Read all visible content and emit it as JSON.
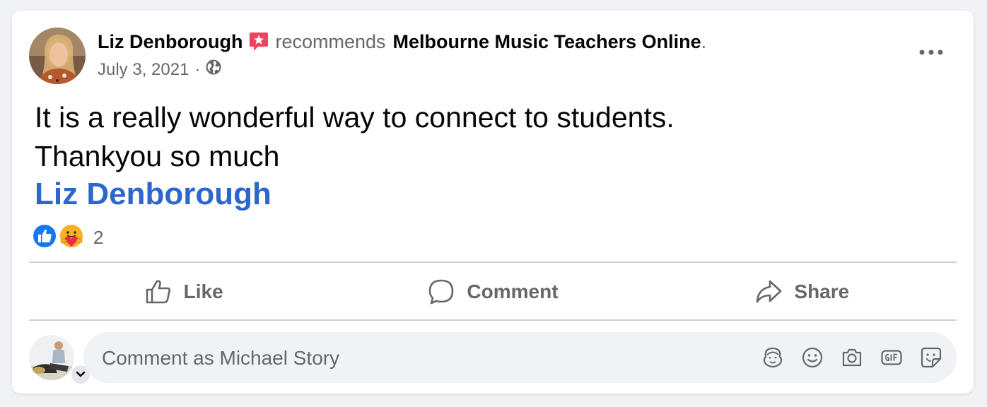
{
  "post": {
    "author": "Liz Denborough",
    "verb": "recommends",
    "page_name": "Melbourne Music Teachers Online",
    "period": ".",
    "date": "July 3, 2021",
    "separator": "·",
    "audience_icon": "globe-icon",
    "badge_icon": "recommend-star-icon",
    "more_icon": "more-options-icon",
    "body_lines": [
      "It is a really wonderful way to connect to students.",
      "Thankyou so much"
    ],
    "mention": "Liz Denborough"
  },
  "reactions": {
    "types": [
      "like",
      "care"
    ],
    "count": "2"
  },
  "actions": {
    "like": "Like",
    "comment": "Comment",
    "share": "Share"
  },
  "composer": {
    "placeholder": "Comment as Michael Story",
    "icons": [
      "avatar-sticker-icon",
      "emoji-icon",
      "camera-icon",
      "gif-icon",
      "sticker-icon"
    ]
  },
  "colors": {
    "link": "#2d66cc",
    "secondary_text": "#65676b",
    "like_blue": "#1877f2",
    "badge_red": "#f3425f"
  }
}
